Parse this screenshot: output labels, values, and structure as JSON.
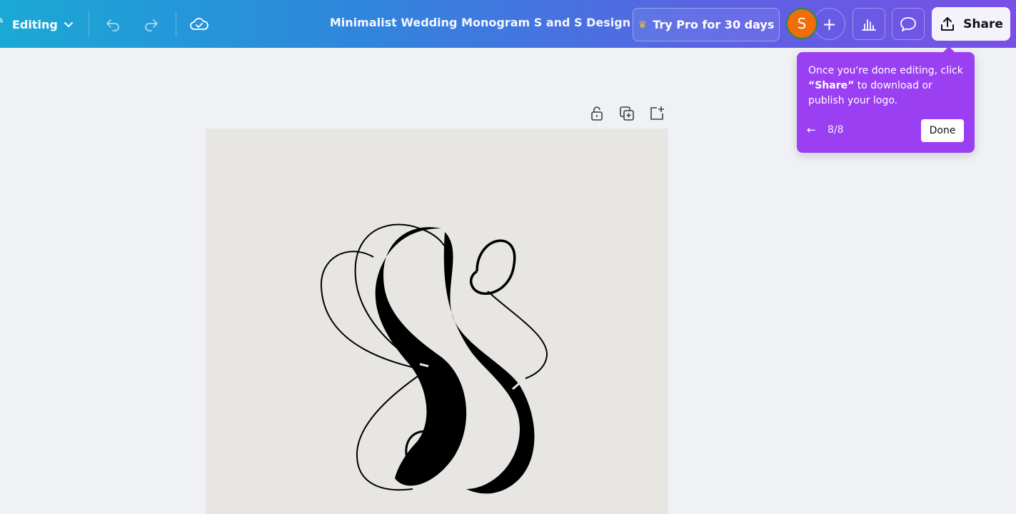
{
  "toolbar": {
    "mode_label": "Editing",
    "doc_title": "Minimalist Wedding Monogram S and S Design",
    "try_pro_label": "Try Pro for 30 days",
    "avatar_initial": "S",
    "plus_symbol": "+",
    "share_label": "Share"
  },
  "icons": {
    "pen": "pencil-icon",
    "chevron": "chevron-down-icon",
    "undo": "undo-icon",
    "redo": "redo-icon",
    "cloud": "cloud-saved-icon",
    "crown": "crown-icon",
    "analytics": "bar-chart-icon",
    "comments": "comment-icon",
    "share": "upload-icon",
    "lock": "lock-icon",
    "duplicate": "duplicate-page-icon",
    "add_page": "add-page-icon"
  },
  "tooltip": {
    "line1": "Once you're done editing, click",
    "bold": "“Share”",
    "line2": " to download or publish your logo.",
    "step": "8/8",
    "back_arrow": "←",
    "done_label": "Done"
  },
  "colors": {
    "topbar_start": "#1aa9d4",
    "topbar_end": "#7a4fe6",
    "tooltip_bg": "#9b3ff3",
    "avatar_bg": "#ef6d0a",
    "canvas_bg": "#eff1f5",
    "page_bg": "#e8e6e3"
  }
}
